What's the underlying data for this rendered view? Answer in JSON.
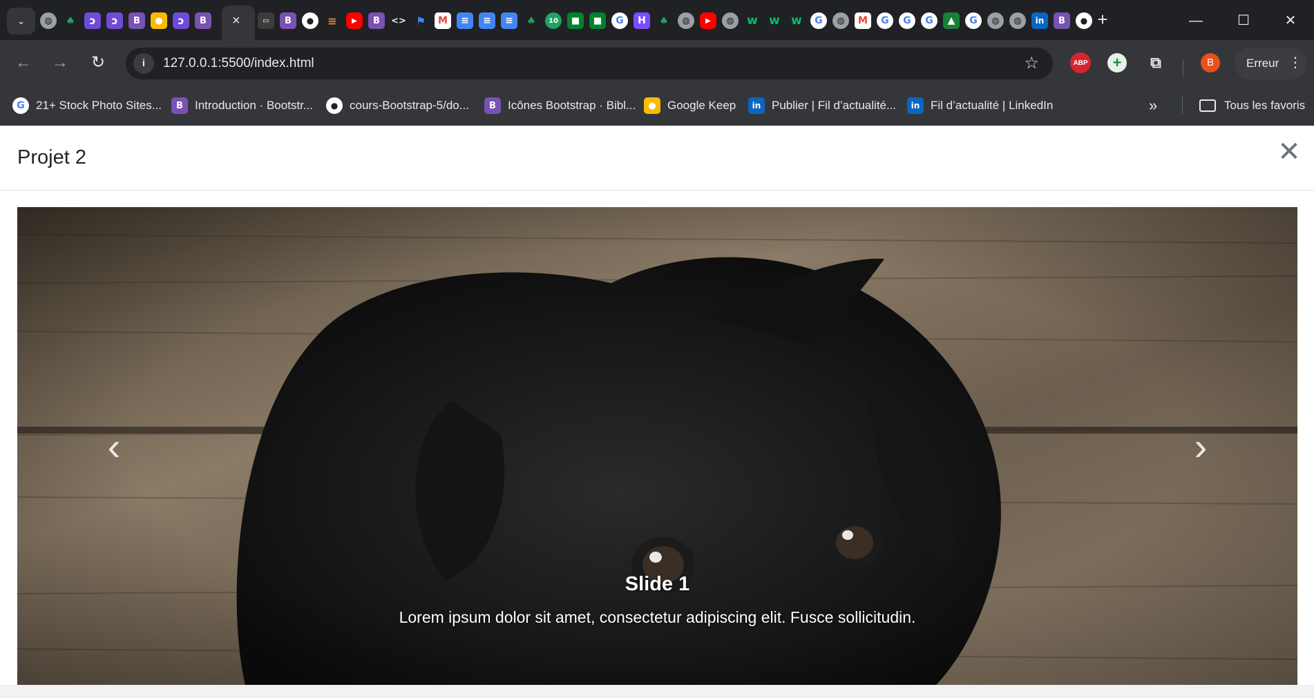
{
  "browser": {
    "url": "127.0.0.1:5500/index.html",
    "profile_initial": "B",
    "profile_status": "Erreur",
    "tab_close_glyph": "×",
    "new_tab_glyph": "+",
    "extensions": {
      "abp_label": "ABP"
    },
    "tab_icons_left": [
      "globe-icon",
      "elephant-icon",
      "c-icon",
      "c-icon",
      "bootstrap-icon",
      "keep-icon",
      "c-icon",
      "bootstrap-icon"
    ],
    "tab_icons_right": [
      "terminal-icon",
      "bootstrap-icon",
      "github-icon",
      "stackoverflow-icon",
      "youtube-icon",
      "bootstrap-icon",
      "code-icon",
      "flag-icon",
      "gmail-icon",
      "docs-icon",
      "docs-icon",
      "docs-icon",
      "elephant-icon",
      "counter-icon",
      "meet-icon",
      "meet-icon",
      "google-icon",
      "h-icon",
      "elephant-icon",
      "globe-icon",
      "youtube-icon",
      "globe-icon",
      "w-icon",
      "w-icon",
      "w-icon",
      "google-icon",
      "globe-icon",
      "gmail-icon",
      "google-icon",
      "google-icon",
      "google-icon",
      "classroom-icon",
      "google-icon",
      "globe-icon",
      "globe-icon",
      "linkedin-icon",
      "bootstrap-icon",
      "github-icon"
    ],
    "counter_badge": "10"
  },
  "bookmarks": [
    {
      "label": "21+ Stock Photo Sites...",
      "icon": "google-icon"
    },
    {
      "label": "Introduction · Bootstr...",
      "icon": "bootstrap-icon"
    },
    {
      "label": "cours-Bootstrap-5/do...",
      "icon": "github-icon"
    },
    {
      "label": "Icônes Bootstrap · Bibl...",
      "icon": "bootstrap-icon"
    },
    {
      "label": "Google Keep",
      "icon": "keep-icon"
    },
    {
      "label": "Publier | Fil d’actualité...",
      "icon": "linkedin-icon"
    },
    {
      "label": "Fil d’actualité | LinkedIn",
      "icon": "linkedin-icon"
    }
  ],
  "bookmarks_all": "Tous les favoris",
  "modal": {
    "title": "Projet 2",
    "close_glyph": "✕"
  },
  "carousel": {
    "slide_title": "Slide 1",
    "slide_text": "Lorem ipsum dolor sit amet, consectetur adipiscing elit. Fusce sollicitudin.",
    "prev_glyph": "‹",
    "next_glyph": "›",
    "image_subject": "black-puppy-on-wooden-floor"
  },
  "colors": {
    "chrome_bg": "#202124",
    "toolbar_bg": "#35363a",
    "bootstrap": "#7952b3",
    "avatar": "#e8511a",
    "abp": "#d6262d"
  }
}
